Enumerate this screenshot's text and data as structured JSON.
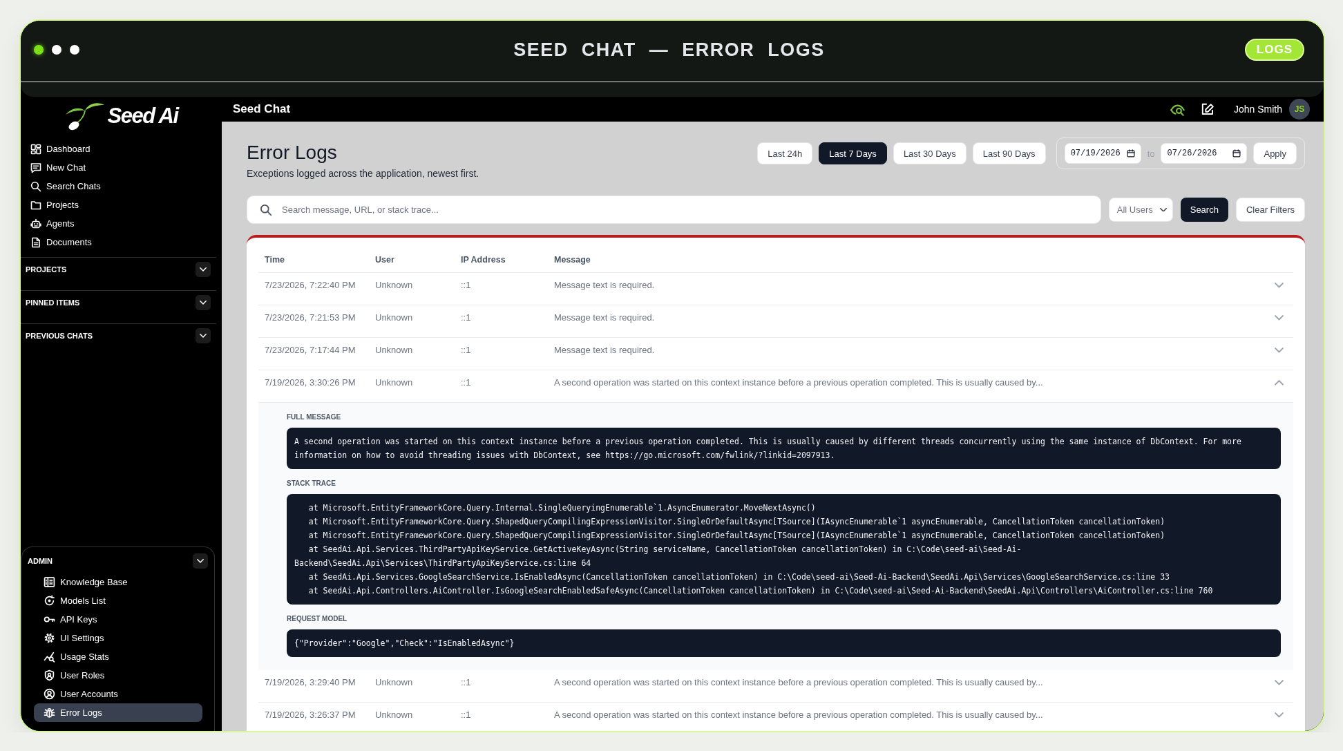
{
  "window": {
    "title": "SEED CHAT — ERROR LOGS",
    "badge": "LOGS"
  },
  "app_header": {
    "title": "Seed Chat",
    "user_name": "John Smith",
    "avatar_initials": "JS"
  },
  "sidebar": {
    "logo": "Seed Ai",
    "nav_items": [
      "Dashboard",
      "New Chat",
      "Search Chats",
      "Projects",
      "Agents",
      "Documents"
    ],
    "sections": [
      "PROJECTS",
      "PINNED ITEMS",
      "PREVIOUS CHATS"
    ],
    "admin": {
      "label": "ADMIN",
      "items": [
        {
          "label": "Knowledge Base",
          "selected": false
        },
        {
          "label": "Models List",
          "selected": false
        },
        {
          "label": "API Keys",
          "selected": false
        },
        {
          "label": "UI Settings",
          "selected": false
        },
        {
          "label": "Usage Stats",
          "selected": false
        },
        {
          "label": "User Roles",
          "selected": false
        },
        {
          "label": "User Accounts",
          "selected": false
        },
        {
          "label": "Error Logs",
          "selected": true
        }
      ]
    }
  },
  "page": {
    "title": "Error Logs",
    "subtitle": "Exceptions logged across the application, newest first.",
    "ranges": [
      {
        "label": "Last 24h",
        "selected": false
      },
      {
        "label": "Last 7 Days",
        "selected": true
      },
      {
        "label": "Last 30 Days",
        "selected": false
      },
      {
        "label": "Last 90 Days",
        "selected": false
      }
    ],
    "date_range": {
      "from": "07/19/2026",
      "separator": "to",
      "to": "07/26/2026",
      "apply": "Apply"
    },
    "search": {
      "placeholder": "Search message, URL, or stack trace..."
    },
    "user_filter": "All Users",
    "search_button": "Search",
    "clear_button": "Clear Filters"
  },
  "table": {
    "columns": [
      "Time",
      "User",
      "IP Address",
      "Message"
    ],
    "rows": [
      {
        "time": "7/23/2026, 7:22:40 PM",
        "user": "Unknown",
        "ip_address": "::1",
        "message": "Message text is required.",
        "expanded": false
      },
      {
        "time": "7/23/2026, 7:21:53 PM",
        "user": "Unknown",
        "ip_address": "::1",
        "message": "Message text is required.",
        "expanded": false
      },
      {
        "time": "7/23/2026, 7:17:44 PM",
        "user": "Unknown",
        "ip_address": "::1",
        "message": "Message text is required.",
        "expanded": false
      },
      {
        "time": "7/19/2026, 3:30:26 PM",
        "user": "Unknown",
        "ip_address": "::1",
        "message": "A second operation was started on this context instance before a previous operation completed. This is usually caused by...",
        "expanded": true,
        "details": {
          "sections": [
            {
              "label": "FULL MESSAGE",
              "lines": [
                "A second operation was started on this context instance before a previous operation completed. This is usually caused by different threads concurrently using the same instance of DbContext. For more information on how to avoid threading issues with DbContext, see https://go.microsoft.com/fwlink/?linkid=2097913."
              ]
            },
            {
              "label": "STACK TRACE",
              "lines": [
                "   at Microsoft.EntityFrameworkCore.Query.Internal.SingleQueryingEnumerable`1.AsyncEnumerator.MoveNextAsync()",
                "   at Microsoft.EntityFrameworkCore.Query.ShapedQueryCompilingExpressionVisitor.SingleOrDefaultAsync[TSource](IAsyncEnumerable`1 asyncEnumerable, CancellationToken cancellationToken)",
                "   at Microsoft.EntityFrameworkCore.Query.ShapedQueryCompilingExpressionVisitor.SingleOrDefaultAsync[TSource](IAsyncEnumerable`1 asyncEnumerable, CancellationToken cancellationToken)",
                "   at SeedAi.Api.Services.ThirdPartyApiKeyService.GetActiveKeyAsync(String serviceName, CancellationToken cancellationToken) in C:\\Code\\seed-ai\\Seed-Ai-Backend\\SeedAi.Api\\Services\\ThirdPartyApiKeyService.cs:line 64",
                "   at SeedAi.Api.Services.GoogleSearchService.IsEnabledAsync(CancellationToken cancellationToken) in C:\\Code\\seed-ai\\Seed-Ai-Backend\\SeedAi.Api\\Services\\GoogleSearchService.cs:line 33",
                "   at SeedAi.Api.Controllers.AiController.IsGoogleSearchEnabledSafeAsync(CancellationToken cancellationToken) in C:\\Code\\seed-ai\\Seed-Ai-Backend\\SeedAi.Api\\Controllers\\AiController.cs:line 760"
              ]
            },
            {
              "label": "REQUEST MODEL",
              "lines": [
                "{\"Provider\":\"Google\",\"Check\":\"IsEnabledAsync\"}"
              ]
            }
          ]
        }
      },
      {
        "time": "7/19/2026, 3:29:40 PM",
        "user": "Unknown",
        "ip_address": "::1",
        "message": "A second operation was started on this context instance before a previous operation completed. This is usually caused by...",
        "expanded": false
      },
      {
        "time": "7/19/2026, 3:26:37 PM",
        "user": "Unknown",
        "ip_address": "::1",
        "message": "A second operation was started on this context instance before a previous operation completed. This is usually caused by...",
        "expanded": false
      }
    ]
  }
}
